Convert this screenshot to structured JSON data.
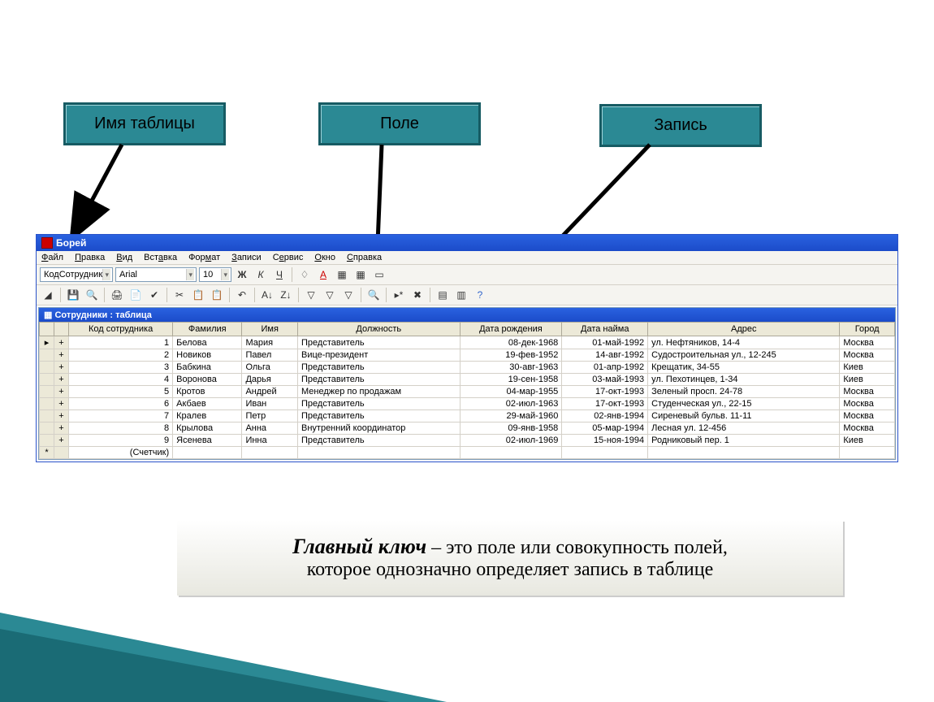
{
  "labels": {
    "tableName": "Имя таблицы",
    "field": "Поле",
    "record": "Запись"
  },
  "window": {
    "title": "Борей",
    "menu": [
      "Файл",
      "Правка",
      "Вид",
      "Вставка",
      "Формат",
      "Записи",
      "Сервис",
      "Окно",
      "Справка"
    ],
    "toolbar1": {
      "field_combo": "КодСотрудник",
      "font_combo": "Arial",
      "size_combo": "10",
      "bold": "Ж",
      "italic": "К",
      "underline": "Ч"
    },
    "subtitle": "Сотрудники : таблица"
  },
  "columns": [
    "Код сотрудника",
    "Фамилия",
    "Имя",
    "Должность",
    "Дата рождения",
    "Дата найма",
    "Адрес",
    "Город"
  ],
  "rows": [
    {
      "id": "1",
      "last": "Белова",
      "first": "Мария",
      "pos": "Представитель",
      "bd": "08-дек-1968",
      "hd": "01-май-1992",
      "addr": "ул. Нефтяников, 14-4",
      "city": "Москва"
    },
    {
      "id": "2",
      "last": "Новиков",
      "first": "Павел",
      "pos": "Вице-президент",
      "bd": "19-фев-1952",
      "hd": "14-авг-1992",
      "addr": "Судостроительная ул., 12-245",
      "city": "Москва"
    },
    {
      "id": "3",
      "last": "Бабкина",
      "first": "Ольга",
      "pos": "Представитель",
      "bd": "30-авг-1963",
      "hd": "01-апр-1992",
      "addr": "Крещатик, 34-55",
      "city": "Киев"
    },
    {
      "id": "4",
      "last": "Воронова",
      "first": "Дарья",
      "pos": "Представитель",
      "bd": "19-сен-1958",
      "hd": "03-май-1993",
      "addr": "ул. Пехотинцев, 1-34",
      "city": "Киев"
    },
    {
      "id": "5",
      "last": "Кротов",
      "first": "Андрей",
      "pos": "Менеджер по продажам",
      "bd": "04-мар-1955",
      "hd": "17-окт-1993",
      "addr": "Зеленый просп. 24-78",
      "city": "Москва"
    },
    {
      "id": "6",
      "last": "Акбаев",
      "first": "Иван",
      "pos": "Представитель",
      "bd": "02-июл-1963",
      "hd": "17-окт-1993",
      "addr": "Студенческая ул., 22-15",
      "city": "Москва"
    },
    {
      "id": "7",
      "last": "Кралев",
      "first": "Петр",
      "pos": "Представитель",
      "bd": "29-май-1960",
      "hd": "02-янв-1994",
      "addr": "Сиреневый бульв. 11-11",
      "city": "Москва"
    },
    {
      "id": "8",
      "last": "Крылова",
      "first": "Анна",
      "pos": "Внутренний координатор",
      "bd": "09-янв-1958",
      "hd": "05-мар-1994",
      "addr": "Лесная ул. 12-456",
      "city": "Москва"
    },
    {
      "id": "9",
      "last": "Ясенева",
      "first": "Инна",
      "pos": "Представитель",
      "bd": "02-июл-1969",
      "hd": "15-ноя-1994",
      "addr": "Родниковый пер. 1",
      "city": "Киев"
    }
  ],
  "newrow": "(Счетчик)",
  "definition": {
    "term": "Главный ключ",
    "rest1": " – это поле или совокупность полей,",
    "rest2": "которое однозначно определяет запись в таблице"
  }
}
